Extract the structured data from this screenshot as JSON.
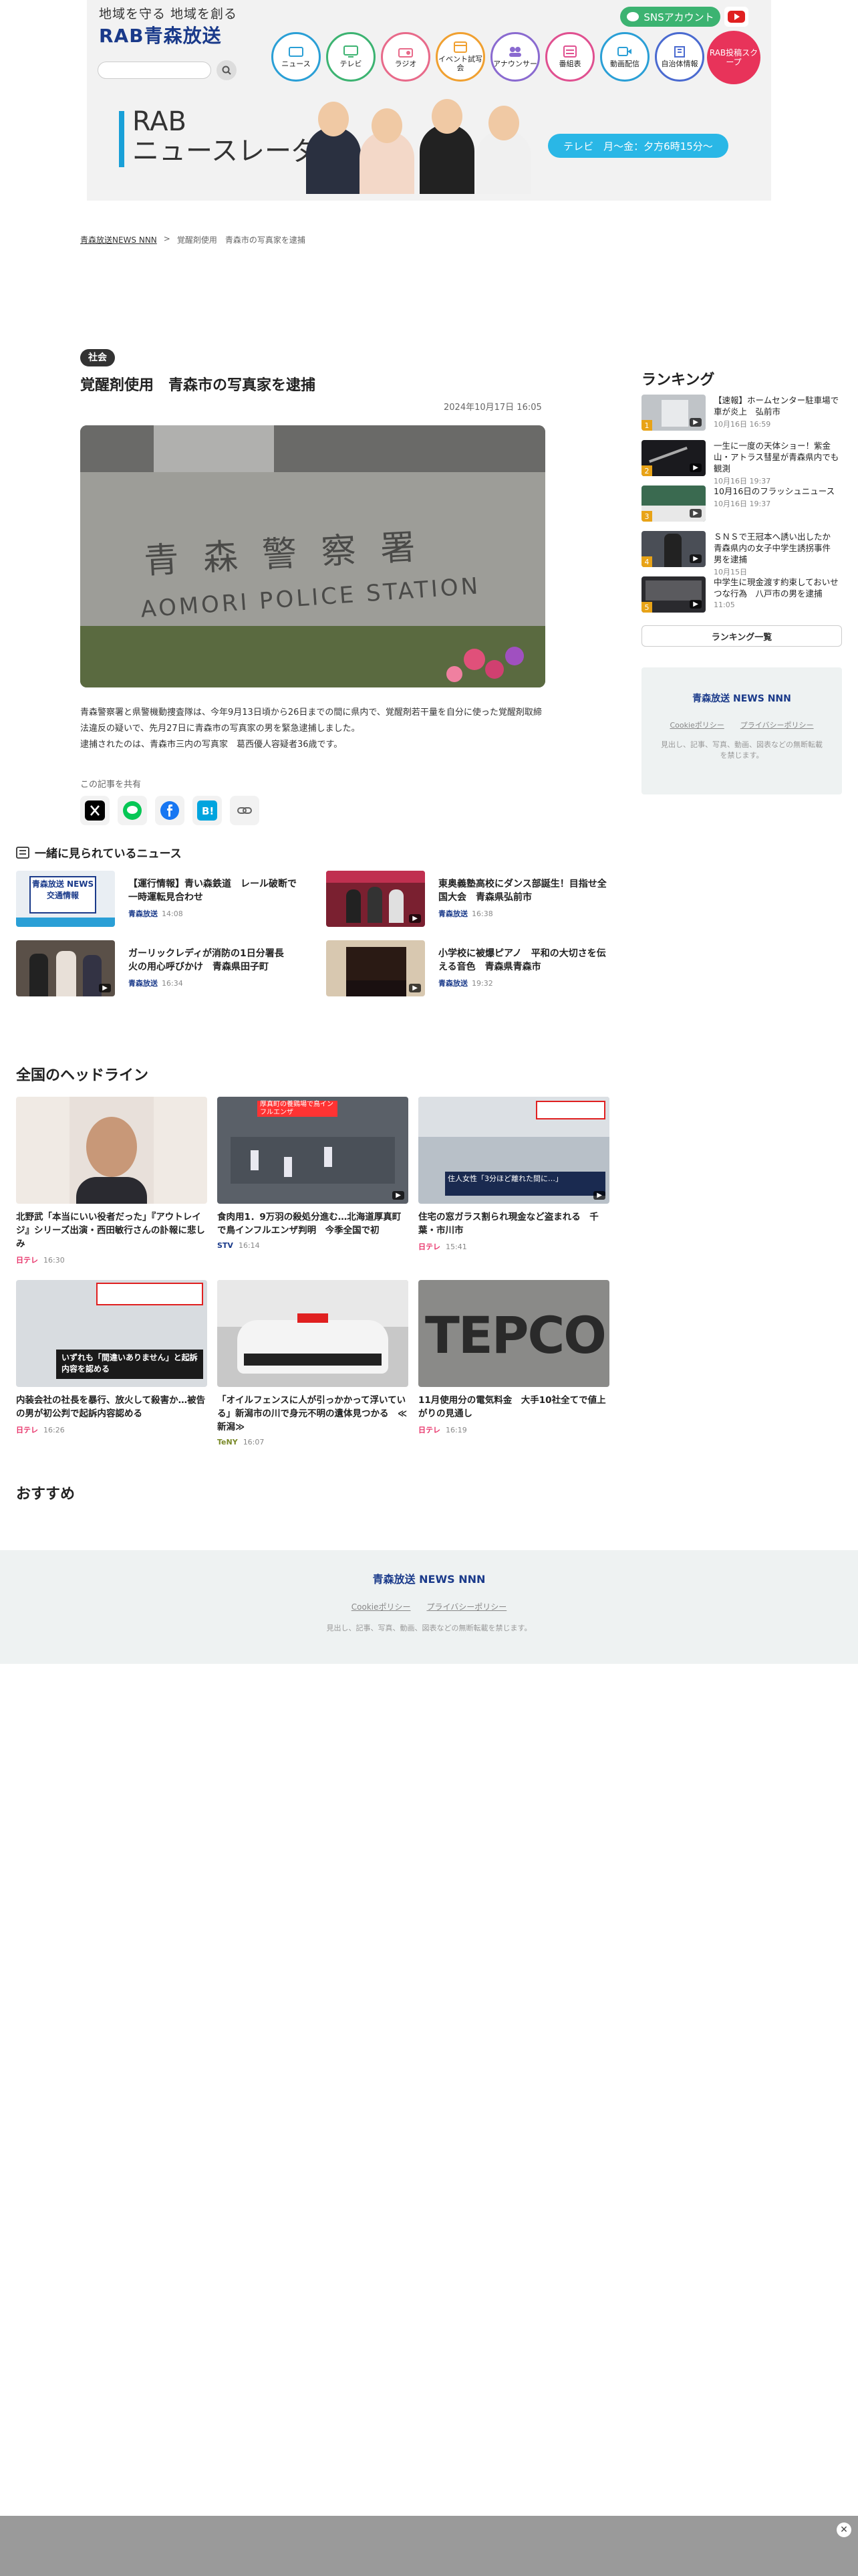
{
  "header": {
    "tagline": "地域を守る 地域を創る",
    "logo": "RAB青森放送",
    "nav": [
      {
        "label": "ニュース",
        "icon": "tv-icon",
        "color": "#2a9fd6"
      },
      {
        "label": "テレビ",
        "icon": "monitor-icon",
        "color": "#3cb371"
      },
      {
        "label": "ラジオ",
        "icon": "radio-icon",
        "color": "#e86a8a"
      },
      {
        "label": "イベント試写会",
        "icon": "calendar-icon",
        "color": "#f0a030"
      },
      {
        "label": "アナウンサー",
        "icon": "people-icon",
        "color": "#8a6ad0"
      },
      {
        "label": "番組表",
        "icon": "list-icon",
        "color": "#e05090"
      },
      {
        "label": "動画配信",
        "icon": "video-icon",
        "color": "#2a9fd6"
      },
      {
        "label": "自治体情報",
        "icon": "building-icon",
        "color": "#4a6ad0"
      }
    ],
    "sns_label": "SNSアカウント",
    "scoop_label": "RAB投稿スクープ",
    "banner_title_1": "RAB",
    "banner_title_2": "ニュースレーダー",
    "banner_tv": "テレビ　月〜金：夕方6時15分〜"
  },
  "breadcrumb": {
    "home": "青森放送NEWS NNN",
    "sep": ">",
    "item1": "覚醒剤使用",
    "item2": "青森市の写真家を逮捕"
  },
  "article": {
    "tag": "社会",
    "title": "覚醒剤使用　青森市の写真家を逮捕",
    "date": "2024年10月17日 16:05",
    "photo_sign": "青 森 警 察 署",
    "photo_sign_en": "AOMORI POLICE STATION",
    "body_1": "青森警察署と県警機動捜査隊は、今年9月13日頃から26日までの間に県内で、覚醒剤若干量を自分に使った覚醒剤取締法違反の疑いで、先月27日に青森市の写真家の男を緊急逮捕しました。",
    "body_2": "逮捕されたのは、青森市三内の写真家　葛西優人容疑者36歳です。",
    "share_label": "この記事を共有"
  },
  "together": {
    "heading": "一緒に見られているニュース",
    "items": [
      {
        "title": "【運行情報】青い森鉄道　レール破断で一時運転見合わせ",
        "source": "青森放送",
        "time": "14:08",
        "thumb_text": "青森放送 NEWS 交通情報"
      },
      {
        "title": "東奥義塾高校にダンス部誕生！目指せ全国大会　青森県弘前市",
        "source": "青森放送",
        "time": "16:38",
        "thumb_text": ""
      },
      {
        "title": "ガーリックレディが消防の1日分署長　火の用心呼びかけ　青森県田子町",
        "source": "青森放送",
        "time": "16:34",
        "thumb_text": ""
      },
      {
        "title": "小学校に被爆ピアノ　平和の大切さを伝える音色　青森県青森市",
        "source": "青森放送",
        "time": "19:32",
        "thumb_text": ""
      }
    ]
  },
  "national": {
    "heading": "全国のヘッドライン",
    "items": [
      {
        "title": "北野武「本当にいい役者だった」『アウトレイジ』シリーズ出演・西田敏行さんの訃報に悲しみ",
        "source": "日テレ",
        "time": "16:30",
        "thumb_text": ""
      },
      {
        "title": "食肉用1．9万羽の殺処分進む…北海道厚真町で鳥インフルエンザ判明　今季全国で初",
        "source": "STV",
        "time": "16:14",
        "thumb_text": "厚真町の養鶏場で鳥インフルエンザ"
      },
      {
        "title": "住宅の窓ガラス割られ現金など盗まれる　千葉・市川市",
        "source": "日テレ",
        "time": "15:41",
        "thumb_text": "住人女性「3分ほど離れた間に…」"
      },
      {
        "title": "内装会社の社長を暴行、放火して殺害か…被告の男が初公判で起訴内容認める",
        "source": "日テレ",
        "time": "16:26",
        "thumb_text": "いずれも「間違いありません」と起訴内容を認める"
      },
      {
        "title": "「オイルフェンスに人が引っかかって浮いている」新潟市の川で身元不明の遺体見つかる　≪新潟≫",
        "source": "TeNY",
        "time": "16:07",
        "thumb_text": ""
      },
      {
        "title": "11月使用分の電気料金　大手10社全てで値上がりの見通し",
        "source": "日テレ",
        "time": "16:19",
        "thumb_text": "TEPCO"
      }
    ]
  },
  "osusume": "おすすめ",
  "ranking": {
    "heading": "ランキング",
    "items": [
      {
        "num": "1",
        "title": "【速報】ホームセンター駐車場で車が炎上　弘前市",
        "date": "10月16日 16:59"
      },
      {
        "num": "2",
        "title": "一生に一度の天体ショー！紫金山・アトラス彗星が青森県内でも観測",
        "date": "10月16日 19:37"
      },
      {
        "num": "3",
        "title": "10月16日のフラッシュニュース",
        "date": "10月16日 19:37"
      },
      {
        "num": "4",
        "title": "ＳＮＳで王冠本へ誘い出したか　青森県内の女子中学生誘拐事件　男を逮捕",
        "date": "10月15日"
      },
      {
        "num": "5",
        "title": "中学生に現金渡す約束しておいせつな行為　八戸市の男を逮捕",
        "date": "11:05"
      }
    ],
    "more_button": "ランキング一覧"
  },
  "sidebox": {
    "logo": "青森放送 NEWS NNN",
    "cookie": "Cookieポリシー",
    "privacy": "プライバシーポリシー",
    "copyright": "見出し、記事、写真、動画、図表などの無断転載を禁じます。"
  },
  "footer": {
    "logo": "青森放送 NEWS NNN",
    "cookie": "Cookieポリシー",
    "privacy": "プライバシーポリシー",
    "copyright": "見出し、記事、写真、動画、図表などの無断転載を禁じます。"
  }
}
